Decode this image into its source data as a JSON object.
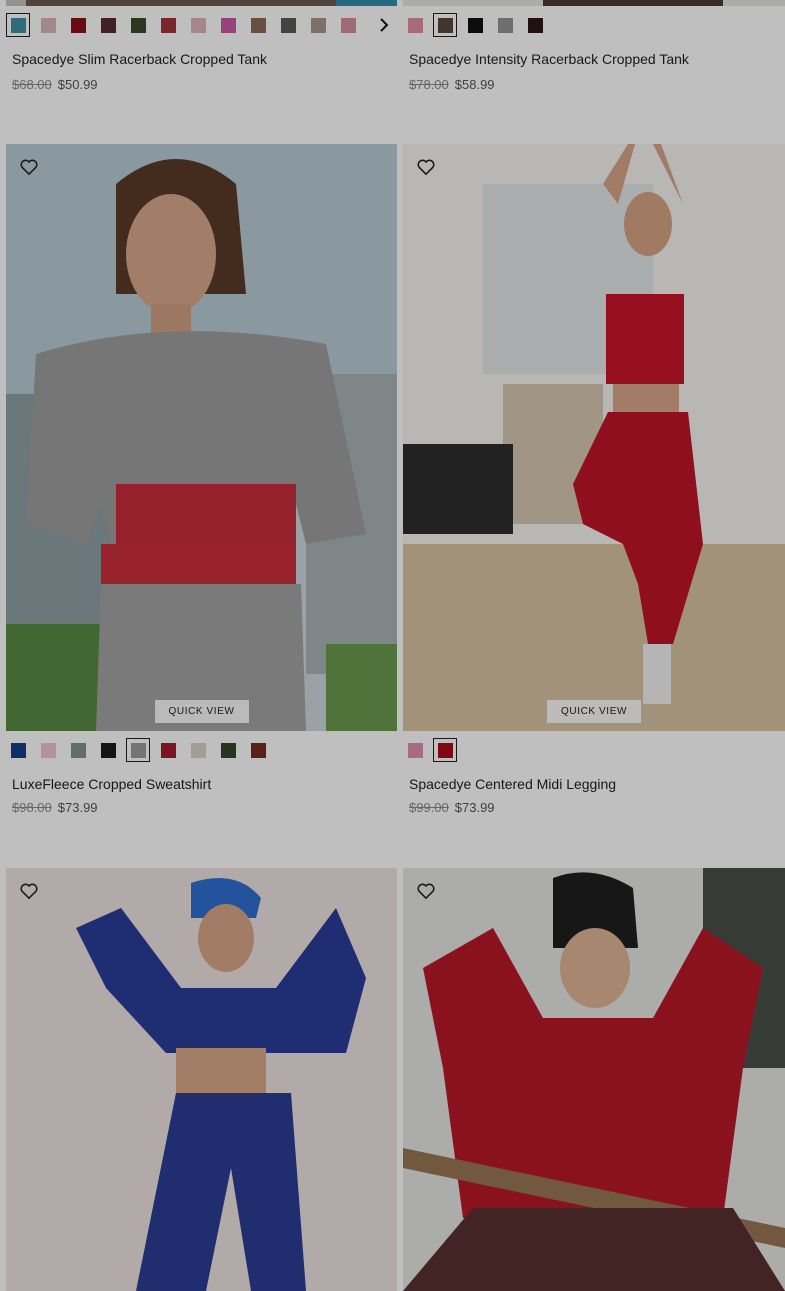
{
  "products": [
    {
      "name": "Spacedye Slim Racerback Cropped Tank",
      "original_price": "$68.00",
      "sale_price": "$50.99",
      "swatches": [
        "#3f8fa5",
        "#d6b7bd",
        "#8c1019",
        "#5a2b36",
        "#3b4a2a",
        "#a4323b",
        "#dcb3b8",
        "#c85aa4",
        "#8c6a55",
        "#5a5a58",
        "#a8968a",
        "#d48ea0"
      ],
      "selected_swatch": 0,
      "has_more_arrow": true
    },
    {
      "name": "Spacedye Intensity Racerback Cropped Tank",
      "original_price": "$78.00",
      "sale_price": "$58.99",
      "swatches": [
        "#dc8fa6",
        "#5a463e",
        "#111111",
        "#939393",
        "#2a1618"
      ],
      "selected_swatch": 1,
      "has_more_arrow": false
    },
    {
      "name": "LuxeFleece Cropped Sweatshirt",
      "original_price": "$98.00",
      "sale_price": "$73.99",
      "quick_view": "QUICK VIEW",
      "swatches": [
        "#143c8c",
        "#f0c2d6",
        "#7f948a",
        "#1c1c1c",
        "#9b9b9b",
        "#a51d2c",
        "#d9d3c4",
        "#2f4a2a",
        "#7a2a22"
      ],
      "selected_swatch": 4,
      "has_more_arrow": false
    },
    {
      "name": "Spacedye Centered Midi Legging",
      "original_price": "$99.00",
      "sale_price": "$73.99",
      "quick_view": "QUICK VIEW",
      "swatches": [
        "#e08fb0",
        "#a80d18"
      ],
      "selected_swatch": 1,
      "has_more_arrow": false
    }
  ]
}
